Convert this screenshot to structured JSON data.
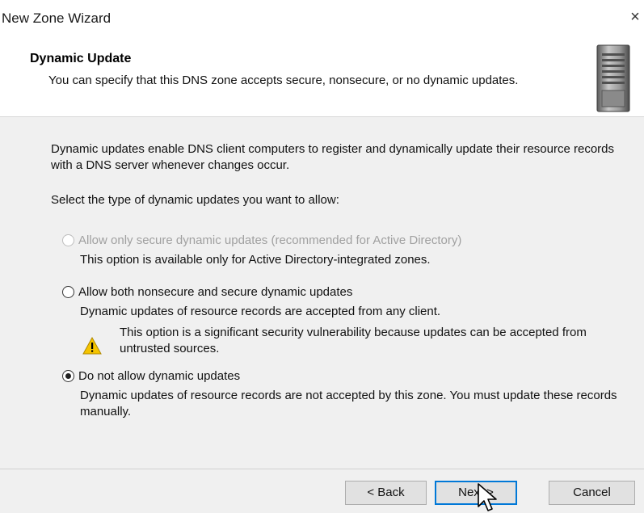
{
  "window": {
    "title": "New Zone Wizard",
    "close_glyph": "×"
  },
  "header": {
    "title": "Dynamic Update",
    "description": "You can specify that this DNS zone accepts secure, nonsecure, or no dynamic updates.",
    "icon": "server-tower-icon"
  },
  "body": {
    "intro": "Dynamic updates enable DNS client computers to register and dynamically update their resource records with a DNS server whenever changes occur.",
    "prompt": "Select the type of dynamic updates you want to allow:",
    "options": [
      {
        "label": "Allow only secure dynamic updates (recommended for Active Directory)",
        "description": "This option is available only for Active Directory-integrated zones.",
        "selected": false,
        "enabled": false
      },
      {
        "label": "Allow both nonsecure and secure dynamic updates",
        "description": "Dynamic updates of resource records are accepted from any client.",
        "warning": "This option is a significant security vulnerability because updates can be accepted from untrusted sources.",
        "warning_icon": "warning-triangle-icon",
        "selected": false,
        "enabled": true
      },
      {
        "label": "Do not allow dynamic updates",
        "description": "Dynamic updates of resource records are not accepted by this zone. You must update these records manually.",
        "selected": true,
        "enabled": true
      }
    ]
  },
  "footer": {
    "back_label": "< Back",
    "next_label": "Next >",
    "cancel_label": "Cancel"
  },
  "colors": {
    "accent": "#0078d7",
    "panel": "#f0f0f0",
    "disabled_text": "#a0a0a0",
    "warning": "#f5c400"
  }
}
